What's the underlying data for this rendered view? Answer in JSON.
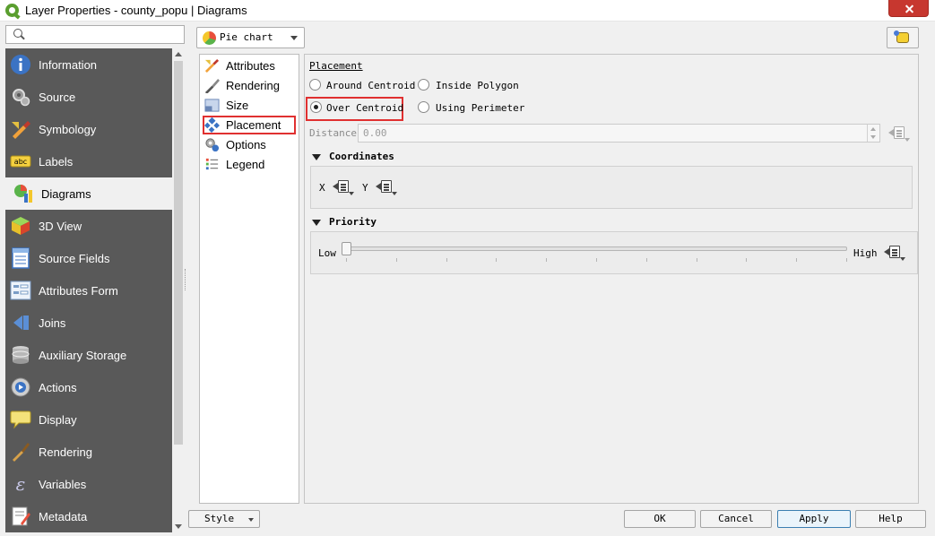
{
  "window": {
    "title": "Layer Properties - county_popu | Diagrams"
  },
  "search": {
    "placeholder": "",
    "value": ""
  },
  "sidebar": {
    "items": [
      {
        "label": "Information",
        "icon": "information-icon"
      },
      {
        "label": "Source",
        "icon": "source-icon"
      },
      {
        "label": "Symbology",
        "icon": "symbology-icon"
      },
      {
        "label": "Labels",
        "icon": "labels-icon"
      },
      {
        "label": "Diagrams",
        "icon": "diagrams-icon",
        "active": true
      },
      {
        "label": "3D View",
        "icon": "3d-view-icon"
      },
      {
        "label": "Source Fields",
        "icon": "source-fields-icon"
      },
      {
        "label": "Attributes Form",
        "icon": "attributes-form-icon"
      },
      {
        "label": "Joins",
        "icon": "joins-icon"
      },
      {
        "label": "Auxiliary Storage",
        "icon": "auxiliary-storage-icon"
      },
      {
        "label": "Actions",
        "icon": "actions-icon"
      },
      {
        "label": "Display",
        "icon": "display-icon"
      },
      {
        "label": "Rendering",
        "icon": "rendering-icon"
      },
      {
        "label": "Variables",
        "icon": "variables-icon"
      },
      {
        "label": "Metadata",
        "icon": "metadata-icon"
      }
    ]
  },
  "renderer": {
    "selected": "Pie chart"
  },
  "subnav": {
    "items": [
      {
        "label": "Attributes",
        "icon": "attributes-icon"
      },
      {
        "label": "Rendering",
        "icon": "rendering-brush-icon"
      },
      {
        "label": "Size",
        "icon": "size-icon"
      },
      {
        "label": "Placement",
        "icon": "placement-icon",
        "selected": true
      },
      {
        "label": "Options",
        "icon": "options-icon"
      },
      {
        "label": "Legend",
        "icon": "legend-icon"
      }
    ]
  },
  "placement": {
    "section_title": "Placement",
    "options": [
      {
        "label": "Around Centroid",
        "checked": false
      },
      {
        "label": "Inside Polygon",
        "checked": false
      },
      {
        "label": "Over Centroid",
        "checked": true
      },
      {
        "label": "Using Perimeter",
        "checked": false
      }
    ],
    "distance_label": "Distance",
    "distance_value": "0.00"
  },
  "coordinates": {
    "title": "Coordinates",
    "x_label": "X",
    "y_label": "Y"
  },
  "priority": {
    "title": "Priority",
    "low_label": "Low",
    "high_label": "High",
    "value_fraction": 0.0
  },
  "footer": {
    "style_label": "Style",
    "ok_label": "OK",
    "cancel_label": "Cancel",
    "apply_label": "Apply",
    "help_label": "Help"
  },
  "colors": {
    "sidebar_bg": "#595959",
    "highlight": "#e03030",
    "close_button": "#c7372f"
  }
}
